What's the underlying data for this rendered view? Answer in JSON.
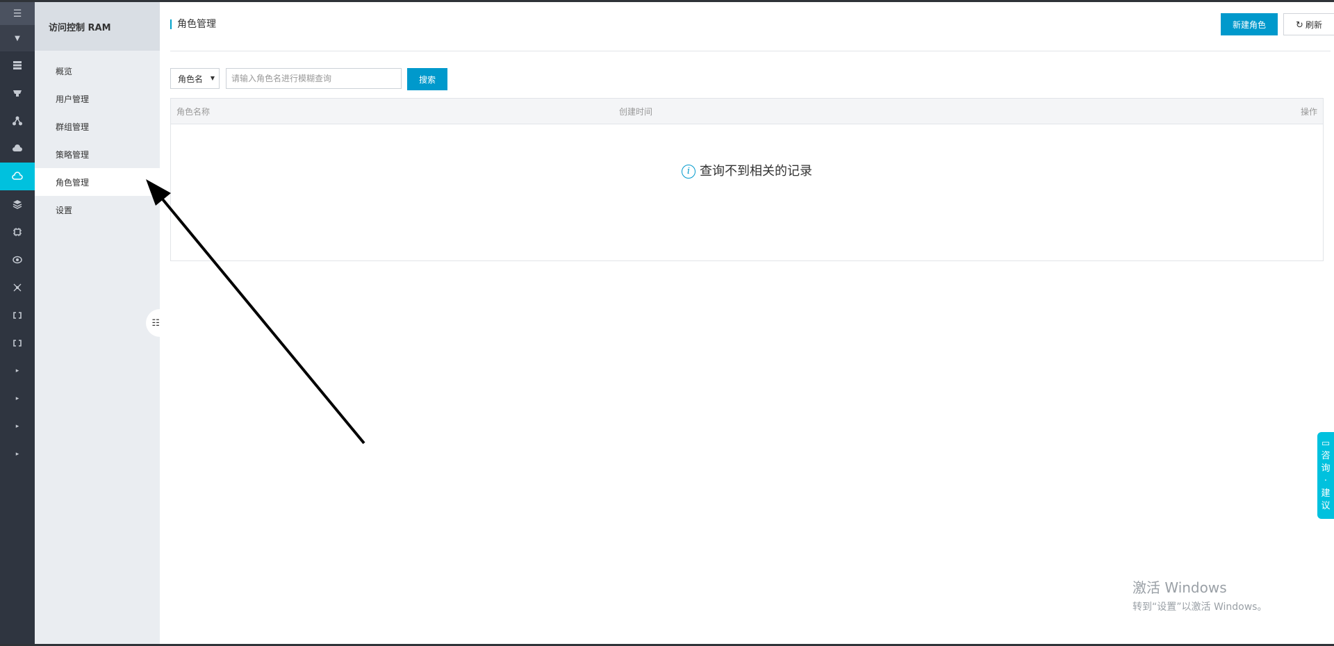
{
  "rail": {
    "top_icon": "menu-icon",
    "collapse_icon": "caret-down-icon",
    "items": [
      "list-icon",
      "ship-icon",
      "network-icon",
      "cloud-up-icon",
      "cloud-active-icon",
      "layers-icon",
      "chip-icon",
      "eye-icon",
      "nodes-icon",
      "link-icon",
      "link2-icon"
    ],
    "arrows": [
      "▸",
      "▸",
      "▸",
      "▸"
    ]
  },
  "subnav": {
    "title": "访问控制 RAM",
    "items": [
      "概览",
      "用户管理",
      "群组管理",
      "策略管理",
      "角色管理",
      "设置"
    ],
    "active_index": 4
  },
  "header": {
    "title": "角色管理",
    "new_role_label": "新建角色",
    "refresh_label": "刷新"
  },
  "search": {
    "select_value": "角色名",
    "placeholder": "请输入角色名进行模糊查询",
    "button_label": "搜索"
  },
  "table": {
    "columns": [
      "角色名称",
      "创建时间",
      "操作"
    ],
    "empty_message": "查询不到相关的记录"
  },
  "consult": [
    "咨",
    "询",
    "·",
    "建",
    "议"
  ],
  "watermark": {
    "line1": "激活 Windows",
    "line2": "转到“设置”以激活 Windows。"
  },
  "colors": {
    "accent": "#0099cc",
    "rail_active": "#00c1de",
    "rail_bg": "#2f3540"
  }
}
